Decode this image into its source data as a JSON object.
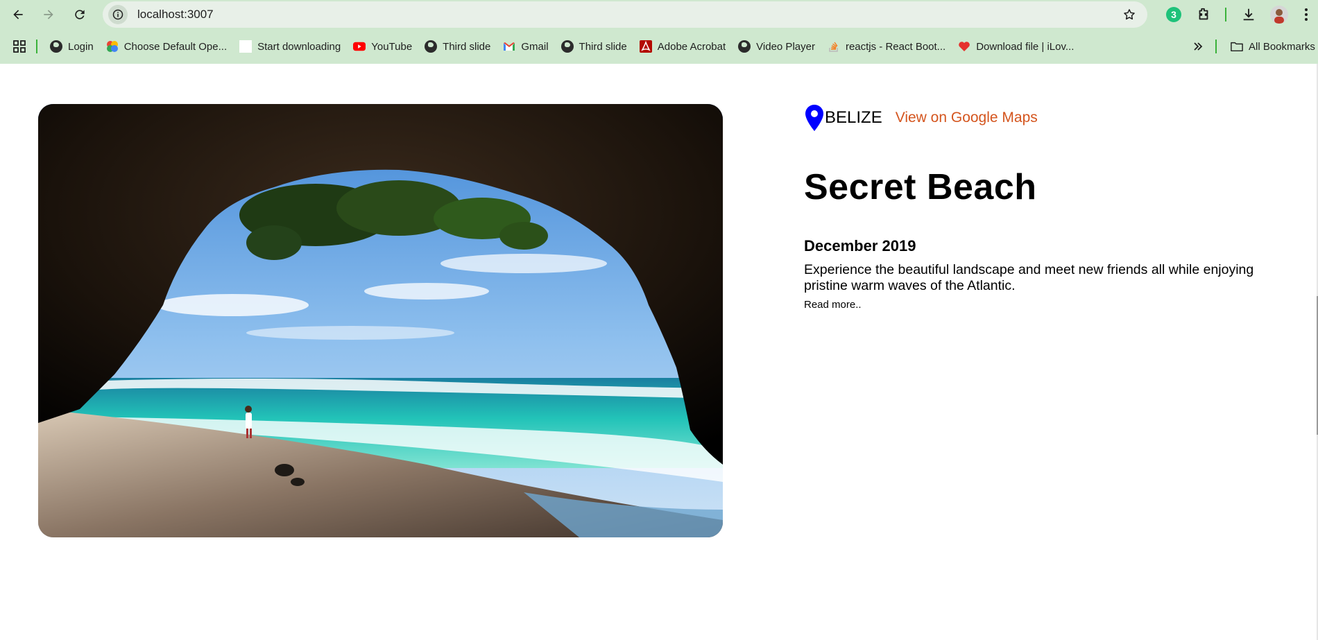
{
  "browser": {
    "url": "localhost:3007",
    "extension_badge": "3",
    "bookmarks": [
      {
        "label": "Login",
        "icon": "globe-icon"
      },
      {
        "label": "Choose Default Ope...",
        "icon": "photos-icon"
      },
      {
        "label": "Start downloading",
        "icon": "blank-page-icon"
      },
      {
        "label": "YouTube",
        "icon": "youtube-icon"
      },
      {
        "label": "Third slide",
        "icon": "globe-icon"
      },
      {
        "label": "Gmail",
        "icon": "gmail-icon"
      },
      {
        "label": "Third slide",
        "icon": "globe-icon"
      },
      {
        "label": "Adobe Acrobat",
        "icon": "acrobat-icon"
      },
      {
        "label": "Video Player",
        "icon": "globe-icon"
      },
      {
        "label": "reactjs - React Boot...",
        "icon": "stackoverflow-icon"
      },
      {
        "label": "Download file | iLov...",
        "icon": "ilovepdf-icon"
      }
    ],
    "all_bookmarks_label": "All Bookmarks"
  },
  "place": {
    "country": "BELIZE",
    "maps_link": "View on Google Maps",
    "title": "Secret Beach",
    "date": "December 2019",
    "description": "Experience the beautiful landscape and meet new friends all while enjoying pristine warm waves of the Atlantic.",
    "read_more": "Read more.."
  },
  "colors": {
    "chrome_bg": "#cfe8cf",
    "omnibox_bg": "#e8f0e8",
    "pin": "#0000ff",
    "link": "#d4551e"
  }
}
